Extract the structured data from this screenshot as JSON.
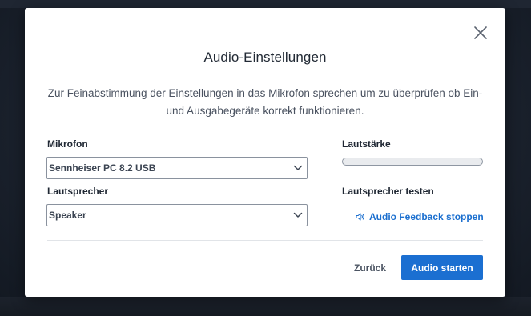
{
  "dialog": {
    "title": "Audio-Einstellungen",
    "description": "Zur Feinabstimmung der Einstellungen in das Mikrofon sprechen um zu überprüfen ob Ein- und Ausgabegeräte korrekt funktionieren.",
    "close_icon": "close-icon"
  },
  "microphone": {
    "label": "Mikrofon",
    "selected": "Sennheiser PC 8.2 USB"
  },
  "speaker": {
    "label": "Lautsprecher",
    "selected": "Speaker"
  },
  "volume": {
    "label": "Lautstärke",
    "level": 0
  },
  "speaker_test": {
    "label": "Lautsprecher testen",
    "link_text": "Audio Feedback stoppen",
    "icon": "speaker-icon"
  },
  "footer": {
    "back_label": "Zurück",
    "start_label": "Audio starten"
  },
  "colors": {
    "accent": "#1b6fd1",
    "link": "#1b6fcf",
    "text": "#222a35"
  }
}
